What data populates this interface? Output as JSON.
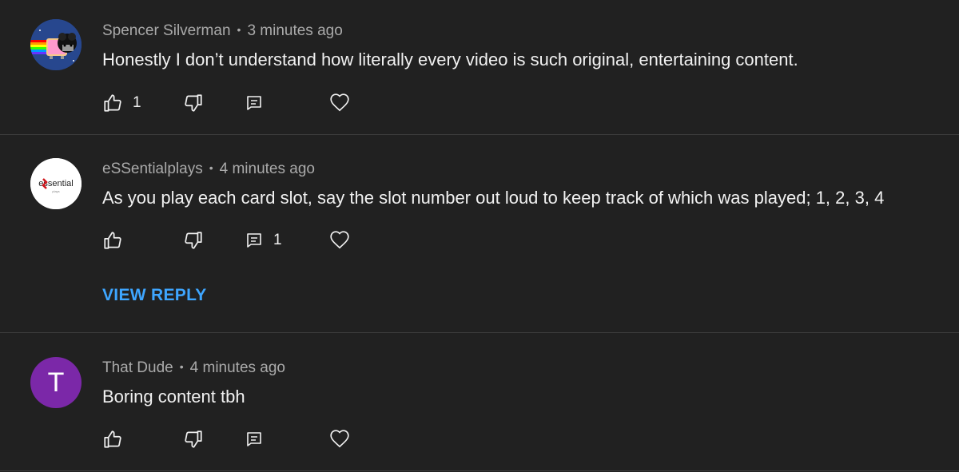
{
  "comments": [
    {
      "author": "Spencer Silverman",
      "time": "3 minutes ago",
      "text": "Honestly I don’t understand how literally every video is such original, entertaining content.",
      "like_count": "1",
      "reply_count": "",
      "avatar": "nyan-cat-avatar"
    },
    {
      "author": "eSSentialplays",
      "time": "4 minutes ago",
      "text": "As you play each card slot, say the slot number out loud to keep track of which was played; 1, 2, 3, 4",
      "like_count": "",
      "reply_count": "1",
      "avatar": "essential-logo-avatar",
      "avatar_text": "essential",
      "view_reply_label": "VIEW REPLY"
    },
    {
      "author": "That Dude",
      "time": "4 minutes ago",
      "text": "Boring content tbh",
      "like_count": "",
      "reply_count": "",
      "avatar_letter": "T",
      "avatar_color": "#7b28a8"
    }
  ],
  "separator": "•",
  "colors": {
    "background": "#212121",
    "meta_text": "#aaaaaa",
    "body_text": "#f1f1f1",
    "link_blue": "#3ea6ff",
    "divider": "#3d3d3d"
  },
  "icons": [
    "thumbs-up-icon",
    "thumbs-down-icon",
    "reply-icon",
    "heart-icon"
  ]
}
